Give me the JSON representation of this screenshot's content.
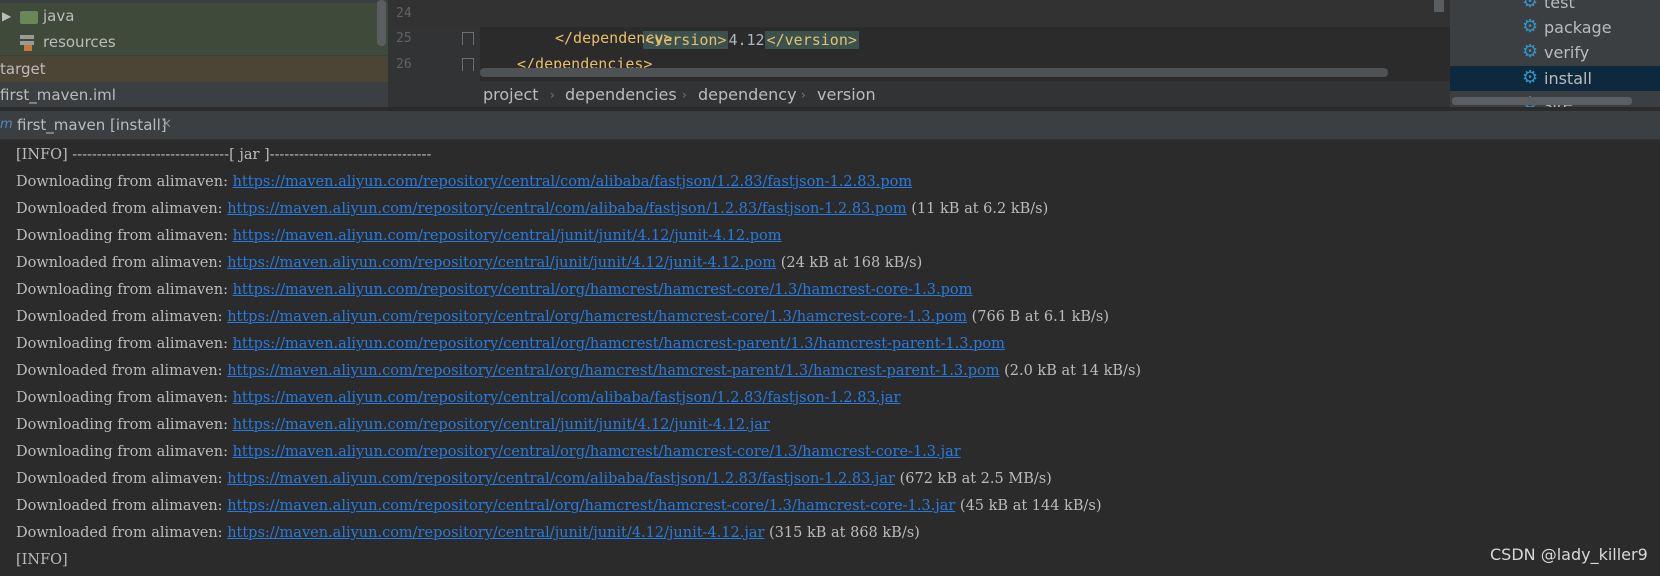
{
  "project_tree": {
    "items": [
      {
        "label": "java",
        "type": "folder"
      },
      {
        "label": "resources",
        "type": "resources"
      },
      {
        "label": "target",
        "type": "excluded"
      },
      {
        "label": "first_maven.iml",
        "type": "file"
      }
    ]
  },
  "editor": {
    "lines": [
      {
        "number": "24",
        "open_tag": "<version>",
        "text": "4.12",
        "close_tag": "</version>"
      },
      {
        "number": "25",
        "tag": "</dependency>"
      },
      {
        "number": "26",
        "tag": "</dependencies>"
      }
    ],
    "breadcrumb": [
      "project",
      "dependencies",
      "dependency",
      "version"
    ]
  },
  "maven": {
    "lifecycle": [
      "test",
      "package",
      "verify",
      "install",
      "site"
    ],
    "selected": "install"
  },
  "run": {
    "tab_label": "first_maven [install]",
    "tab_icon": "m"
  },
  "console": {
    "header": "[INFO] --------------------------------[ jar ]---------------------------------",
    "lines": [
      {
        "prefix": "Downloading from alimaven: ",
        "url": "https://maven.aliyun.com/repository/central/com/alibaba/fastjson/1.2.83/fastjson-1.2.83.pom",
        "suffix": ""
      },
      {
        "prefix": "Downloaded from alimaven: ",
        "url": "https://maven.aliyun.com/repository/central/com/alibaba/fastjson/1.2.83/fastjson-1.2.83.pom",
        "suffix": " (11 kB at 6.2 kB/s)"
      },
      {
        "prefix": "Downloading from alimaven: ",
        "url": "https://maven.aliyun.com/repository/central/junit/junit/4.12/junit-4.12.pom",
        "suffix": ""
      },
      {
        "prefix": "Downloaded from alimaven: ",
        "url": "https://maven.aliyun.com/repository/central/junit/junit/4.12/junit-4.12.pom",
        "suffix": " (24 kB at 168 kB/s)"
      },
      {
        "prefix": "Downloading from alimaven: ",
        "url": "https://maven.aliyun.com/repository/central/org/hamcrest/hamcrest-core/1.3/hamcrest-core-1.3.pom",
        "suffix": ""
      },
      {
        "prefix": "Downloaded from alimaven: ",
        "url": "https://maven.aliyun.com/repository/central/org/hamcrest/hamcrest-core/1.3/hamcrest-core-1.3.pom",
        "suffix": " (766 B at 6.1 kB/s)"
      },
      {
        "prefix": "Downloading from alimaven: ",
        "url": "https://maven.aliyun.com/repository/central/org/hamcrest/hamcrest-parent/1.3/hamcrest-parent-1.3.pom",
        "suffix": ""
      },
      {
        "prefix": "Downloaded from alimaven: ",
        "url": "https://maven.aliyun.com/repository/central/org/hamcrest/hamcrest-parent/1.3/hamcrest-parent-1.3.pom",
        "suffix": " (2.0 kB at 14 kB/s)"
      },
      {
        "prefix": "Downloading from alimaven: ",
        "url": "https://maven.aliyun.com/repository/central/com/alibaba/fastjson/1.2.83/fastjson-1.2.83.jar",
        "suffix": ""
      },
      {
        "prefix": "Downloading from alimaven: ",
        "url": "https://maven.aliyun.com/repository/central/junit/junit/4.12/junit-4.12.jar",
        "suffix": ""
      },
      {
        "prefix": "Downloading from alimaven: ",
        "url": "https://maven.aliyun.com/repository/central/org/hamcrest/hamcrest-core/1.3/hamcrest-core-1.3.jar",
        "suffix": ""
      },
      {
        "prefix": "Downloaded from alimaven: ",
        "url": "https://maven.aliyun.com/repository/central/com/alibaba/fastjson/1.2.83/fastjson-1.2.83.jar",
        "suffix": " (672 kB at 2.5 MB/s)"
      },
      {
        "prefix": "Downloaded from alimaven: ",
        "url": "https://maven.aliyun.com/repository/central/org/hamcrest/hamcrest-core/1.3/hamcrest-core-1.3.jar",
        "suffix": " (45 kB at 144 kB/s)"
      },
      {
        "prefix": "Downloaded from alimaven: ",
        "url": "https://maven.aliyun.com/repository/central/junit/junit/4.12/junit-4.12.jar",
        "suffix": " (315 kB at 868 kB/s)"
      }
    ],
    "footer": "[INFO]"
  },
  "watermark": "CSDN @lady_killer9",
  "colors": {
    "background": "#2b2b2b",
    "panel": "#3c3f41",
    "link": "#287bde",
    "xml_tag": "#e8bf6a",
    "selection": "#0d293e",
    "gear": "#3592c4"
  }
}
